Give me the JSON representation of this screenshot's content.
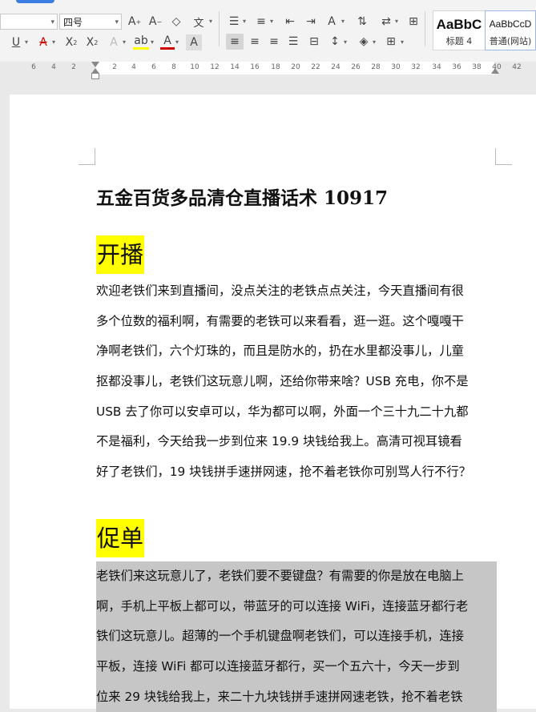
{
  "toolbar": {
    "font_size": "四号",
    "style_heading4_preview": "AaBbC",
    "style_heading4_label": "标题 4",
    "style_normal_preview": "AaBbCcD",
    "style_normal_label": "普通(网站)"
  },
  "ruler": {
    "ticks": [
      "6",
      "4",
      "2",
      "2",
      "4",
      "6",
      "8",
      "10",
      "12",
      "14",
      "16",
      "18",
      "20",
      "22",
      "24",
      "26",
      "28",
      "30",
      "32",
      "34",
      "36",
      "38",
      "40",
      "42"
    ]
  },
  "document": {
    "title": "五金百货多品清仓直播话术 10917",
    "section1": {
      "heading": "开播",
      "lines": [
        "欢迎老铁们来到直播间，没点关注的老铁点点关注，今天直播间有很",
        "多个位数的福利啊，有需要的老铁可以来看看，逛一逛。这个嘎嘎干",
        "净啊老铁们，六个灯珠的，而且是防水的，扔在水里都没事儿，儿童",
        "抠都没事儿，老铁们这玩意儿啊，还给你带来啥？USB 充电，你不是",
        "USB 去了你可以安卓可以，华为都可以啊，外面一个三十九二十九都",
        "不是福利，今天给我一步到位来 19.9 块钱给我上。高清可视耳镜看",
        "好了老铁们，19 块钱拼手速拼网速，抢不着老铁你可别骂人行不行？"
      ]
    },
    "section2": {
      "heading": "促单",
      "lines": [
        "老铁们来这玩意儿了，老铁们要不要键盘？有需要的你是放在电脑上",
        "啊，手机上平板上都可以，带蓝牙的可以连接 WiFi，连接蓝牙都行老",
        "铁们这玩意儿。超薄的一个手机键盘啊老铁们，可以连接手机，连接",
        "平板，连接 WiFi 都可以连接蓝牙都行，买一个五六十，今天一步到",
        "位来 29 块钱给我上，来二十九块钱拼手速拼网速老铁，抢不着老铁"
      ]
    }
  }
}
